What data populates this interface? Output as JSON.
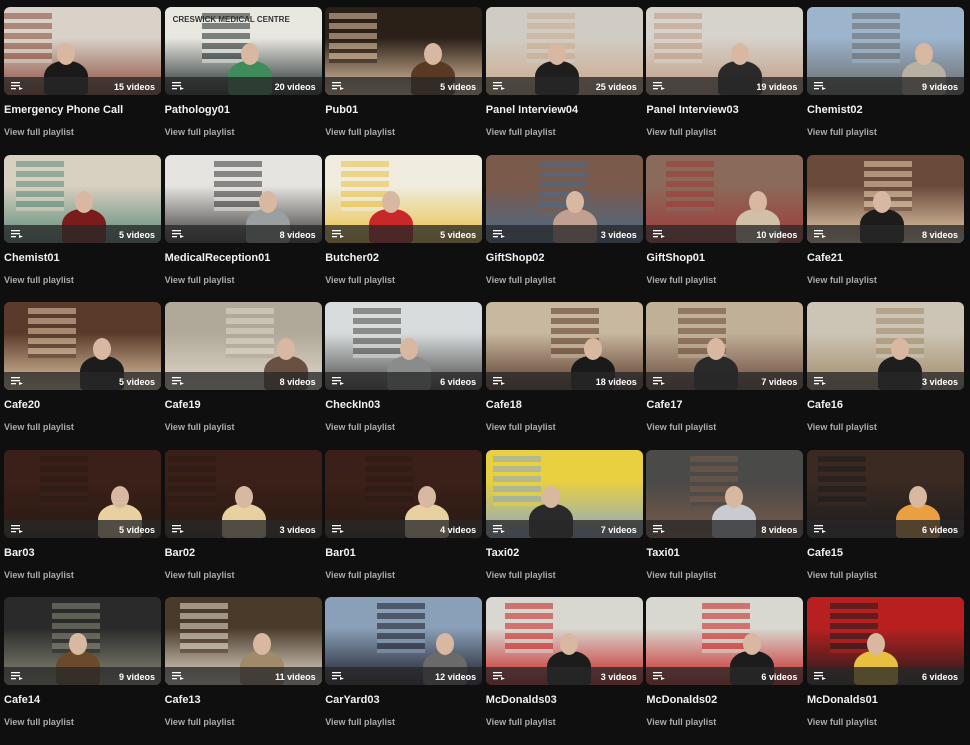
{
  "view_label": "View full playlist",
  "playlists": [
    {
      "title": "Emergency Phone Call",
      "count": "15 videos",
      "colors": [
        "#d8d2c8",
        "#1a1a1a",
        "#8a4a3a"
      ]
    },
    {
      "title": "Pathology01",
      "count": "20 videos",
      "colors": [
        "#e8e8e0",
        "#3f8b5c",
        "#1f2a2a"
      ],
      "sign_text": "CRESWICK MEDICAL CENTRE"
    },
    {
      "title": "Pub01",
      "count": "5 videos",
      "colors": [
        "#2a2018",
        "#5a3a22",
        "#e8c8a8"
      ]
    },
    {
      "title": "Panel Interview04",
      "count": "25 videos",
      "colors": [
        "#d0ccc4",
        "#1e1e1e",
        "#caa98a"
      ]
    },
    {
      "title": "Panel Interview03",
      "count": "19 videos",
      "colors": [
        "#d6d2cc",
        "#2a2a2a",
        "#c09a80"
      ]
    },
    {
      "title": "Chemist02",
      "count": "9 videos",
      "colors": [
        "#9cb4cc",
        "#b8b0a2",
        "#6a6a6a"
      ]
    },
    {
      "title": "Chemist01",
      "count": "5 videos",
      "colors": [
        "#d8d0c0",
        "#7a1c1c",
        "#5a8a7a"
      ]
    },
    {
      "title": "MedicalReception01",
      "count": "8 videos",
      "colors": [
        "#e6e4e0",
        "#9aa0a0",
        "#3a3a3a"
      ]
    },
    {
      "title": "Butcher02",
      "count": "5 videos",
      "colors": [
        "#f0ece0",
        "#c82828",
        "#e8c040"
      ]
    },
    {
      "title": "GiftShop02",
      "count": "3 videos",
      "colors": [
        "#7a5a4a",
        "#c0a090",
        "#4a6a8a"
      ]
    },
    {
      "title": "GiftShop01",
      "count": "10 videos",
      "colors": [
        "#8a6a5a",
        "#d0c0a8",
        "#a03a3a"
      ]
    },
    {
      "title": "Cafe21",
      "count": "8 videos",
      "colors": [
        "#6a4a3a",
        "#1c1c1c",
        "#e8d0b0"
      ]
    },
    {
      "title": "Cafe20",
      "count": "5 videos",
      "colors": [
        "#5a3a2a",
        "#1c1c1c",
        "#e0c8a8"
      ]
    },
    {
      "title": "Cafe19",
      "count": "8 videos",
      "colors": [
        "#b0a898",
        "#6a5040",
        "#e0d8c8"
      ]
    },
    {
      "title": "CheckIn03",
      "count": "6 videos",
      "colors": [
        "#d8dcdc",
        "#8a8c8c",
        "#4a4a48"
      ]
    },
    {
      "title": "Cafe18",
      "count": "18 videos",
      "colors": [
        "#c8b8a0",
        "#1a1a1a",
        "#5a3a2a"
      ]
    },
    {
      "title": "Cafe17",
      "count": "7 videos",
      "colors": [
        "#c0b098",
        "#2a2a2a",
        "#6a4a3a"
      ]
    },
    {
      "title": "Cafe16",
      "count": "3 videos",
      "colors": [
        "#ccc4b4",
        "#1e1e1e",
        "#a08a6a"
      ]
    },
    {
      "title": "Bar03",
      "count": "5 videos",
      "colors": [
        "#3a2018",
        "#e8d0a0",
        "#2a1a14"
      ]
    },
    {
      "title": "Bar02",
      "count": "3 videos",
      "colors": [
        "#3a2018",
        "#e8d0a0",
        "#2a1a14"
      ]
    },
    {
      "title": "Bar01",
      "count": "4 videos",
      "colors": [
        "#3a2018",
        "#e8d0a0",
        "#2a1a14"
      ]
    },
    {
      "title": "Taxi02",
      "count": "7 videos",
      "colors": [
        "#e8d040",
        "#2a2a2a",
        "#8aa8c8"
      ]
    },
    {
      "title": "Taxi01",
      "count": "8 videos",
      "colors": [
        "#4a4a48",
        "#c8ccd0",
        "#7a5a4a"
      ]
    },
    {
      "title": "Cafe15",
      "count": "6 videos",
      "colors": [
        "#3a2a22",
        "#e8a040",
        "#1c1c1c"
      ]
    },
    {
      "title": "Cafe14",
      "count": "9 videos",
      "colors": [
        "#2a2a2a",
        "#6a4a2a",
        "#8a8a7a"
      ]
    },
    {
      "title": "Cafe13",
      "count": "11 videos",
      "colors": [
        "#4a3a2a",
        "#a08a6a",
        "#e8e0d0"
      ]
    },
    {
      "title": "CarYard03",
      "count": "12 videos",
      "colors": [
        "#8aa0b8",
        "#6a6a6a",
        "#1e1e2a"
      ]
    },
    {
      "title": "McDonalds03",
      "count": "3 videos",
      "colors": [
        "#d8d8d0",
        "#1c1c1c",
        "#c82020"
      ]
    },
    {
      "title": "McDonalds02",
      "count": "6 videos",
      "colors": [
        "#d8d8d0",
        "#1c1c1c",
        "#c82020"
      ]
    },
    {
      "title": "McDonalds01",
      "count": "6 videos",
      "colors": [
        "#b82020",
        "#e8c040",
        "#1c1c1c"
      ]
    }
  ]
}
